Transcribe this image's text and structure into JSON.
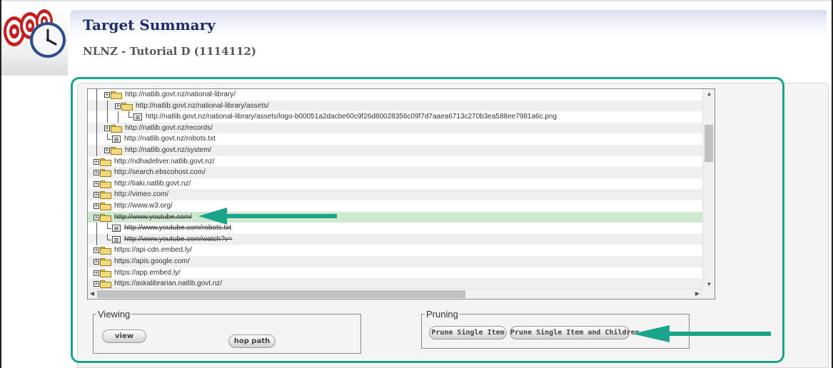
{
  "header": {
    "title": "Target Summary",
    "subtitle": "NLNZ - Tutorial D (1114112)",
    "logo": "target-clock-logo"
  },
  "tree": {
    "rows": [
      {
        "label": "http://natlib.govt.nz/national-library/",
        "type": "folder",
        "level": 1,
        "pruned": false
      },
      {
        "label": "http://natlib.govt.nz/national-library/assets/",
        "type": "folder",
        "level": 2,
        "pruned": false
      },
      {
        "label": "http://natlib.govt.nz/national-library/assets/logo-b00051a2dacbe60c9f26d80028356c09f7d7aaea6713c270b3ea588ee7981a6c.png",
        "type": "file",
        "level": 3,
        "pruned": false
      },
      {
        "label": "http://natlib.govt.nz/records/",
        "type": "folder",
        "level": 1,
        "pruned": false
      },
      {
        "label": "http://natlib.govt.nz/robots.txt",
        "type": "file",
        "level": 1,
        "pruned": false
      },
      {
        "label": "http://natlib.govt.nz/system/",
        "type": "folder",
        "level": 1,
        "pruned": false
      },
      {
        "label": "http://ndhadeliver.natlib.govt.nz/",
        "type": "folder",
        "level": 0,
        "pruned": false
      },
      {
        "label": "http://search.ebscohost.com/",
        "type": "folder",
        "level": 0,
        "pruned": false
      },
      {
        "label": "http://tiaki.natlib.govt.nz/",
        "type": "folder",
        "level": 0,
        "pruned": false
      },
      {
        "label": "http://vimeo.com/",
        "type": "folder",
        "level": 0,
        "pruned": false
      },
      {
        "label": "http://www.w3.org/",
        "type": "folder",
        "level": 0,
        "pruned": false
      },
      {
        "label": "http://www.youtube.com/",
        "type": "folder",
        "level": 0,
        "pruned": true,
        "selected": true
      },
      {
        "label": "http://www.youtube.com/robots.txt",
        "type": "file",
        "level": 1,
        "pruned": true
      },
      {
        "label": "http://www.youtube.com/watch?v=",
        "type": "file",
        "level": 1,
        "pruned": true
      },
      {
        "label": "https://api-cdn.embed.ly/",
        "type": "folder",
        "level": 0,
        "pruned": false
      },
      {
        "label": "https://apis.google.com/",
        "type": "folder",
        "level": 0,
        "pruned": false
      },
      {
        "label": "https://app.embed.ly/",
        "type": "folder",
        "level": 0,
        "pruned": false
      },
      {
        "label": "https://askalibrarian.natlib.govt.nz/",
        "type": "folder",
        "level": 0,
        "pruned": false
      }
    ]
  },
  "viewing": {
    "legend": "Viewing",
    "view_label": "view",
    "hop_path_label": "hop path"
  },
  "pruning": {
    "legend": "Pruning",
    "prune_single_label": "Prune Single Item",
    "prune_children_label": "Prune Single Item and Children"
  },
  "colors": {
    "highlight_border": "#1aa58a",
    "arrow": "#1aa58a",
    "selected_row": "#cfe9cf",
    "title": "#1c2e6e"
  }
}
